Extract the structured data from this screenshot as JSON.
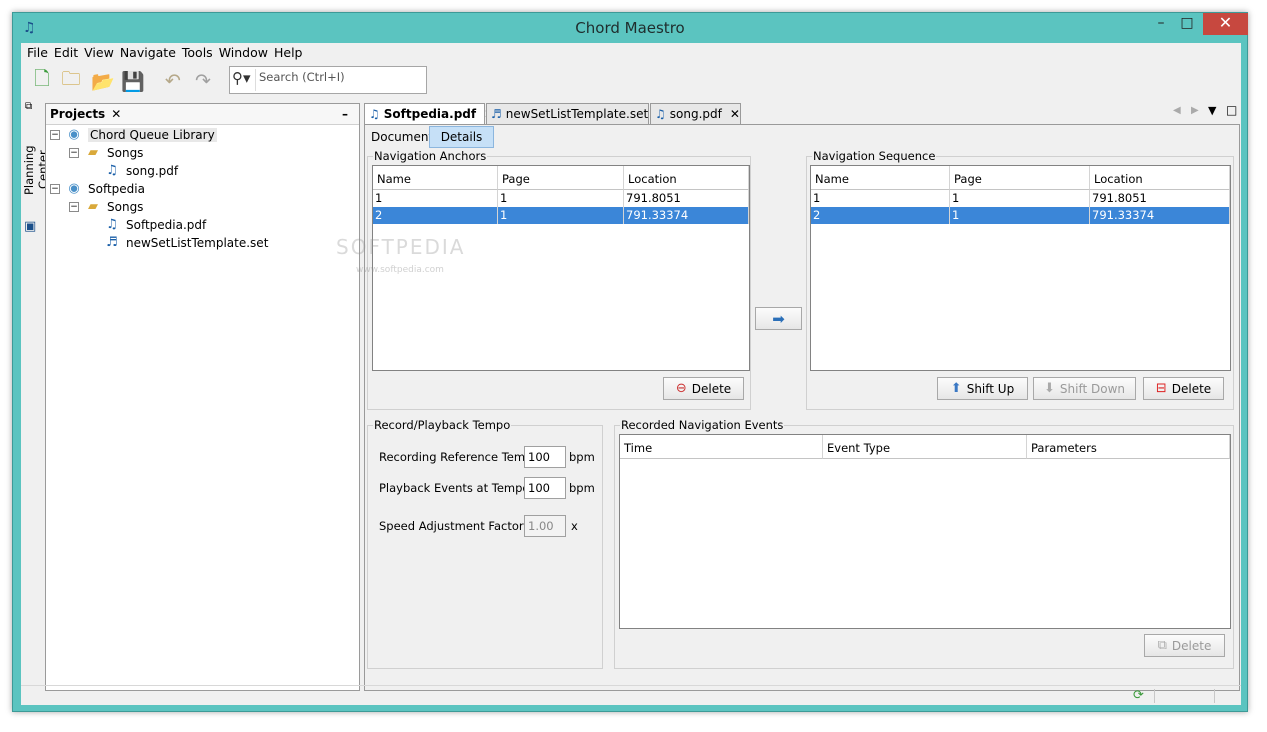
{
  "window": {
    "title": "Chord Maestro"
  },
  "menu": [
    "File",
    "Edit",
    "View",
    "Navigate",
    "Tools",
    "Window",
    "Help"
  ],
  "search": {
    "placeholder": "Search (Ctrl+I)"
  },
  "side_strip": {
    "label": "Planning Center"
  },
  "projects": {
    "tab_label": "Projects",
    "tree": [
      {
        "label": "Chord Queue Library",
        "icon": "library-disc-icon",
        "expander": "−"
      },
      {
        "label": "Songs",
        "icon": "folder-icon",
        "expander": "−"
      },
      {
        "label": "song.pdf",
        "icon": "music-note-icon"
      },
      {
        "label": "Softpedia",
        "icon": "library-disc-icon",
        "expander": "−"
      },
      {
        "label": "Songs",
        "icon": "folder-icon",
        "expander": "−"
      },
      {
        "label": "Softpedia.pdf",
        "icon": "music-note-icon"
      },
      {
        "label": "newSetListTemplate.set",
        "icon": "set-list-icon"
      }
    ]
  },
  "editor": {
    "tabs": [
      {
        "label": "Softpedia.pdf"
      },
      {
        "label": "newSetListTemplate.set"
      },
      {
        "label": "song.pdf"
      }
    ],
    "subtabs": [
      "Document",
      "Details"
    ]
  },
  "anchors": {
    "title": "Navigation Anchors",
    "columns": [
      "Name",
      "Page",
      "Location"
    ],
    "rows": [
      [
        "1",
        "1",
        "791.8051"
      ],
      [
        "2",
        "1",
        "791.33374"
      ]
    ],
    "delete_label": "Delete"
  },
  "sequence": {
    "title": "Navigation Sequence",
    "columns": [
      "Name",
      "Page",
      "Location"
    ],
    "rows": [
      [
        "1",
        "1",
        "791.8051"
      ],
      [
        "2",
        "1",
        "791.33374"
      ]
    ],
    "shift_up_label": "Shift Up",
    "shift_down_label": "Shift Down",
    "delete_label": "Delete"
  },
  "tempo": {
    "title": "Record/Playback Tempo",
    "recording_label": "Recording Reference Tempo:",
    "recording_value": "100",
    "recording_unit": "bpm",
    "playback_label": "Playback Events at Tempo:",
    "playback_value": "100",
    "playback_unit": "bpm",
    "speed_label": "Speed Adjustment Factor:",
    "speed_value": "1.00",
    "speed_unit": "x"
  },
  "events": {
    "title": "Recorded Navigation Events",
    "columns": [
      "Time",
      "Event Type",
      "Parameters"
    ],
    "delete_label": "Delete"
  },
  "watermark": {
    "text": "SOFTPEDIA",
    "sub": "www.softpedia.com"
  },
  "colors": {
    "window_frame": "#5bc4c0",
    "selection": "#3b86d8",
    "close_button": "#c7483f"
  }
}
